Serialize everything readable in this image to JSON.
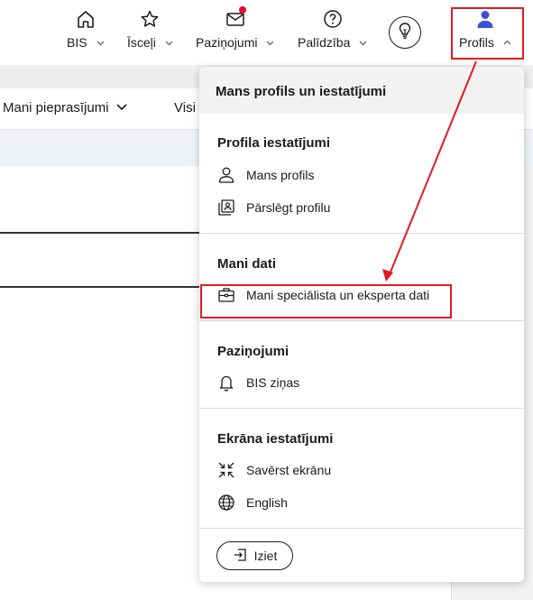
{
  "nav": {
    "items": [
      {
        "label": "BIS",
        "icon": "home-icon"
      },
      {
        "label": "Īsceļi",
        "icon": "star-icon"
      },
      {
        "label": "Paziņojumi",
        "icon": "mail-icon"
      },
      {
        "label": "Palīdzība",
        "icon": "help-icon"
      }
    ],
    "ideas_icon": "lightbulb-icon",
    "profile": {
      "label": "Profils",
      "icon": "person-icon",
      "expanded": true
    }
  },
  "filters": {
    "tab1": "Mani pieprasījumi",
    "tab2": "Visi"
  },
  "dropdown": {
    "title": "Mans profils un iestatījumi",
    "sections": [
      {
        "title": "Profila iestatījumi",
        "items": [
          {
            "label": "Mans profils",
            "icon": "person-outline-icon"
          },
          {
            "label": "Pārslēgt profilu",
            "icon": "switch-profile-icon"
          }
        ]
      },
      {
        "title": "Mani dati",
        "items": [
          {
            "label": "Mani speciālista un eksperta dati",
            "icon": "briefcase-icon",
            "highlighted": true
          }
        ]
      },
      {
        "title": "Paziņojumi",
        "items": [
          {
            "label": "BIS ziņas",
            "icon": "bell-icon"
          }
        ]
      },
      {
        "title": "Ekrāna iestatījumi",
        "items": [
          {
            "label": "Savērst ekrānu",
            "icon": "collapse-arrows-icon"
          },
          {
            "label": "English",
            "icon": "globe-icon"
          }
        ]
      }
    ],
    "logout": {
      "label": "Iziet",
      "icon": "logout-icon"
    }
  },
  "colors": {
    "accent": "#3b4fd8",
    "annotation": "#e21a22",
    "notification": "#e4002b",
    "text": "#1b1b1b",
    "header_bg": "#f2f2f2"
  }
}
